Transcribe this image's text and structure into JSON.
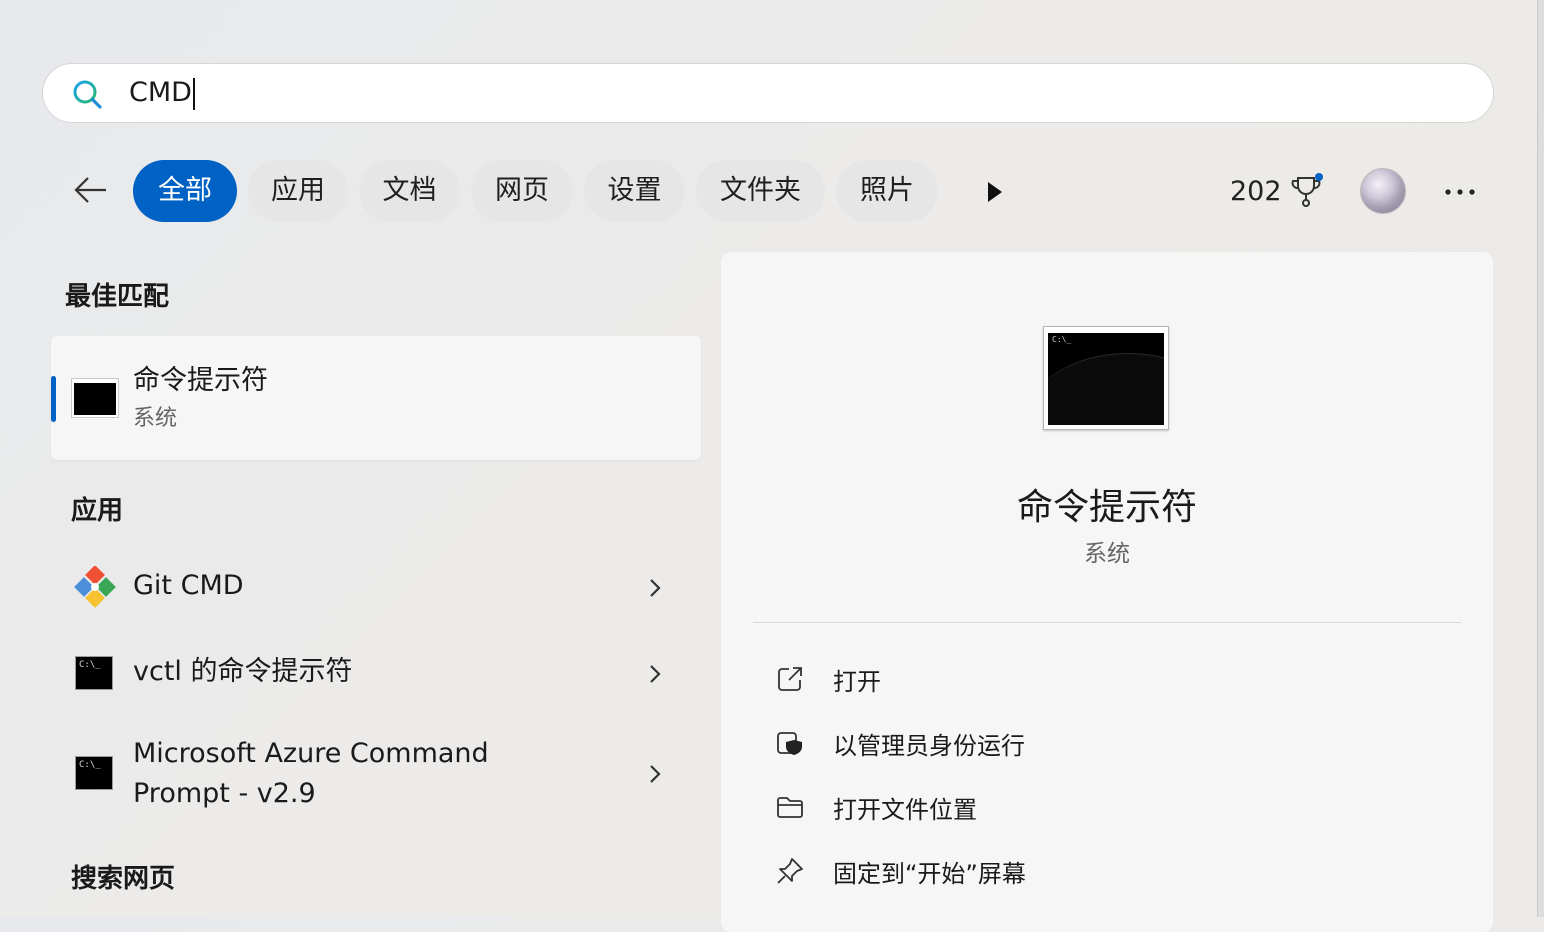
{
  "search": {
    "query": "CMD"
  },
  "filters": {
    "chips": [
      "全部",
      "应用",
      "文档",
      "网页",
      "设置",
      "文件夹",
      "照片"
    ]
  },
  "header": {
    "points": "202"
  },
  "sections": {
    "best_match": "最佳匹配",
    "apps": "应用",
    "web": "搜索网页"
  },
  "best_match": {
    "name": "命令提示符",
    "type": "系统"
  },
  "apps": [
    {
      "name": "Git CMD"
    },
    {
      "name": "vctl 的命令提示符"
    },
    {
      "name_line1": "Microsoft Azure Command",
      "name_line2": "Prompt - v2.9"
    }
  ],
  "detail": {
    "title": "命令提示符",
    "subtitle": "系统",
    "icon_text": "C:\\_",
    "actions": [
      {
        "label": "打开",
        "icon": "open-external-icon"
      },
      {
        "label": "以管理员身份运行",
        "icon": "shield-icon"
      },
      {
        "label": "打开文件位置",
        "icon": "folder-icon"
      },
      {
        "label": "固定到“开始”屏幕",
        "icon": "pin-icon"
      }
    ]
  },
  "colors": {
    "accent": "#0062c4"
  }
}
